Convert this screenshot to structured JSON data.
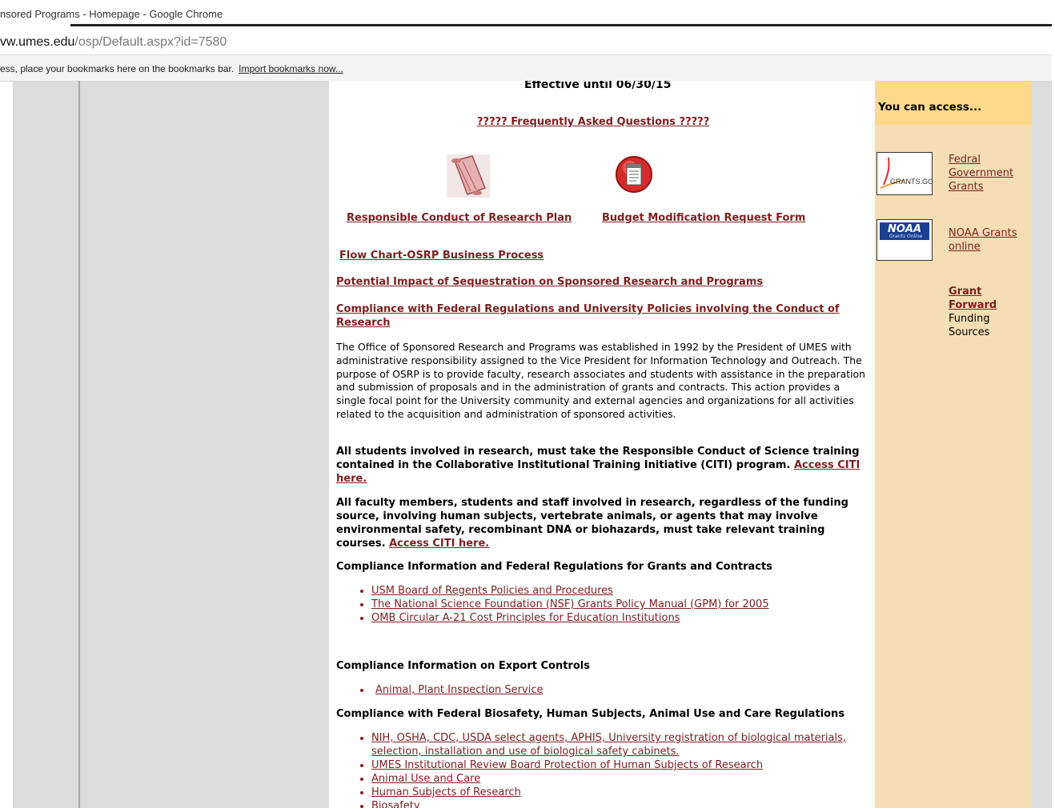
{
  "browser": {
    "title": "nsored Programs - Homepage - Google Chrome",
    "url_host": "vw.umes.edu",
    "url_path": "/osp/Default.aspx?id=7580",
    "bookmarks_text": "ess, place your bookmarks here on the bookmarks bar.",
    "bookmarks_link": "Import bookmarks now..."
  },
  "main": {
    "effective": "Effective until 06/30/15",
    "faq": "????? Frequently Asked Questions ????? ",
    "rcr_plan": "Responsible Conduct of Research Plan",
    "budget_form": "Budget Modification Request Form",
    "flow_chart": "Flow Chart-OSRP Business Process",
    "sequestration": "Potential Impact of Sequestration on Sponsored Research and Programs ",
    "compliance_link": "Compliance with Federal Regulations and University Policies involving the Conduct of Research",
    "about": "The Office of Sponsored Research and Programs was established in 1992 by the President of UMES with administrative responsibility assigned to the Vice President for Information Technology and Outreach. The purpose of OSRP is to provide faculty, research associates and students with assistance in the preparation and submission of proposals and in the administration of grants and contracts. This action provides a single focal point for the University community and external agencies and organizations for all activities related to the acquisition and administration of sponsored activities.",
    "students_text": "All students involved in research, must take the Responsible Conduct of Science training contained in the Collaborative Institutional Training Initiative (CITI) program.",
    "students_link": "Access CITI here.",
    "faculty_text": "All faculty members, students and staff involved in research, regardless of the funding source, involving human subjects, vertebrate animals, or agents that may involve environmental safety, recombinant DNA or biohazards, must take relevant training courses.",
    "faculty_link": "Access CITI here.",
    "heading_grants": "Compliance Information and Federal Regulations for Grants and Contracts",
    "grants_links": [
      "USM Board of Regents Policies and Procedures",
      "The National Science Foundation (NSF) Grants Policy Manual (GPM) for 2005",
      "OMB Circular A-21 Cost Principles for Education Institutions"
    ],
    "heading_export": "Compliance Information on Export Controls",
    "export_links": [
      "Animal, Plant Inspection Service"
    ],
    "heading_bio": "Compliance with Federal Biosafety, Human Subjects, Animal Use and Care Regulations",
    "bio_links": [
      "NIH, OSHA, CDC, USDA select agents, APHIS, University registration of biological materials, selection, installation and use of biological safety cabinets.",
      "UMES Institutional Review Board Protection of Human Subjects of Research",
      "Animal Use and Care",
      "Human Subjects of Research",
      "Biosafety"
    ]
  },
  "sidebar": {
    "heading": "You can access...",
    "grants_gov_logo": "GRANTS.GOV",
    "grants_gov_link": "Fedral Government Grants",
    "noaa_logo": "NOAA",
    "noaa_logo_sub": "Grants Online",
    "noaa_link": "NOAA Grants online",
    "grant_forward_link": "Grant Forward",
    "grant_forward_text": "Funding Sources"
  },
  "icons": {
    "scroll": "scroll-icon",
    "form": "form-icon",
    "arrow": "arrow-right-icon"
  },
  "colors": {
    "link": "#7a1f1f",
    "sidebar_bg": "#f5deb3",
    "sidebar_head": "#ffd98a",
    "arrow": "#5b9bd5"
  }
}
